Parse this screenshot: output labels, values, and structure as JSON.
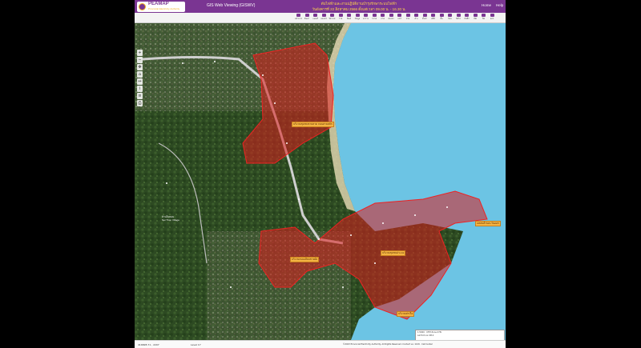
{
  "header": {
    "logo_text": "PEAMAP",
    "logo_sub": "Provincial Electricity Authority",
    "app_title": "GIS Web Viewing (GISWV)",
    "banner_line1": "ดับไฟฟ้าและงานปฏิบัติงานบำรุงรักษาระบบไฟฟ้า",
    "banner_line2": "วันอังคารที่ 22 สิงหาคม 2566 ตั้งแต่เวลา 09.00 น. - 16.30 น.",
    "menu_home": "Home",
    "menu_help": "Help"
  },
  "toolbar": {
    "tools": [
      "หน้าแรก",
      "ค้นหา",
      "แผนที่",
      "เลเยอร์",
      "วัดระยะ",
      "วาด",
      "พิมพ์",
      "ข้อมูล",
      "ตาราง",
      "กราฟ",
      "ภาพ",
      "ส่งออก",
      "แชร์",
      "ช่วย",
      "ล้าง",
      "ตั้งค่า",
      "สถิติ",
      "ชั้น",
      "ย้อน",
      "ถัดไป",
      "บันทึก",
      "เปิด",
      "ปิด",
      "ออก"
    ]
  },
  "map": {
    "labels": [
      "บริเวณชุมชนชายหาด ถนนสายหลัก",
      "บริเวณถนนเลียบชายฝั่ง",
      "บริเวณชุมชนประมง",
      "แหลมด้านตะวันออก",
      "บริเวณท่าเรือ"
    ],
    "place_name": "บ้านในทอน",
    "place_sub": "Nai Thon Village"
  },
  "scale_box": {
    "line1": "1:5000 · UTM Zone 47N",
    "line2": "Lat 8.0 Lon 98.2"
  },
  "status": {
    "coords": "416828.71 , 2207",
    "zoom": "Level 17",
    "copyright": "©2023 Provincial Electricity Authority. All Rights Reserved. Contact us: 1129 · Call Center"
  }
}
